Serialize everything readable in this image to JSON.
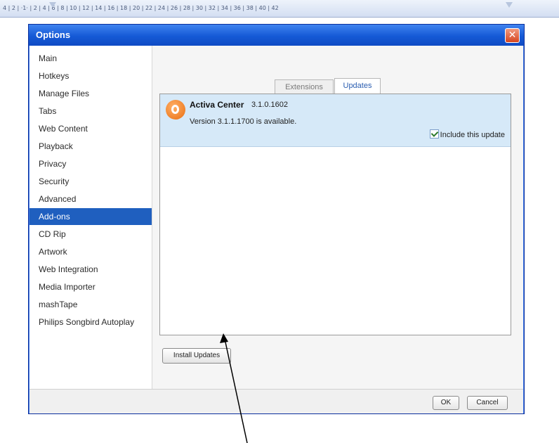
{
  "ruler": {
    "text": "4 | 2 | ·1· | 2 | 4 | 6 | 8 | 10 | 12 | 14 | 16 | 18 | 20 | 22 | 24 | 26 | 28 | 30 | 32 | 34 | 36 | 38 | 40 | 42"
  },
  "window": {
    "title": "Options",
    "close_glyph": "✕"
  },
  "nav": {
    "items": [
      {
        "label": "Main"
      },
      {
        "label": "Hotkeys"
      },
      {
        "label": "Manage Files"
      },
      {
        "label": "Tabs"
      },
      {
        "label": "Web Content"
      },
      {
        "label": "Playback"
      },
      {
        "label": "Privacy"
      },
      {
        "label": "Security"
      },
      {
        "label": "Advanced"
      },
      {
        "label": "Add-ons",
        "selected": true
      },
      {
        "label": "CD Rip"
      },
      {
        "label": "Artwork"
      },
      {
        "label": "Web Integration"
      },
      {
        "label": "Media Importer"
      },
      {
        "label": "mashTape"
      },
      {
        "label": "Philips Songbird Autoplay"
      }
    ]
  },
  "tabs": [
    {
      "label": "Extensions",
      "active": false
    },
    {
      "label": "Updates",
      "active": true
    }
  ],
  "update": {
    "icon": "activa-logo-icon",
    "name": "Activa Center",
    "version": "3.1.0.1602",
    "available_text": "Version 3.1.1.1700 is available.",
    "include_label": "Include this update",
    "include_checked": true
  },
  "buttons": {
    "install": "Install Updates",
    "ok": "OK",
    "cancel": "Cancel"
  },
  "colors": {
    "titlebar": "#1559d6",
    "selected_nav": "#1f5fbf",
    "update_row": "#d6e9f8"
  }
}
